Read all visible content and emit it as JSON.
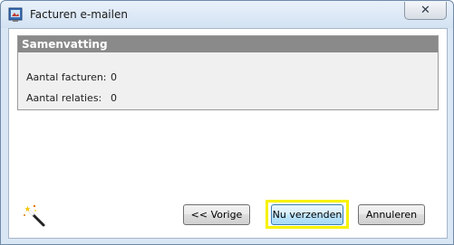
{
  "window": {
    "title": "Facturen e-mailen",
    "close_label": "✕"
  },
  "summary": {
    "header": "Samenvatting",
    "rows": [
      {
        "label": "Aantal facturen:",
        "value": "0"
      },
      {
        "label": "Aantal relaties:",
        "value": "0"
      }
    ]
  },
  "buttons": {
    "previous": "<< Vorige",
    "send": "Nu verzenden",
    "cancel": "Annuleren"
  },
  "icons": {
    "app": "app-window-icon",
    "wizard": "magic-wand-icon"
  },
  "colors": {
    "highlight": "#f7f200",
    "panel_header": "#8a8a8a"
  }
}
